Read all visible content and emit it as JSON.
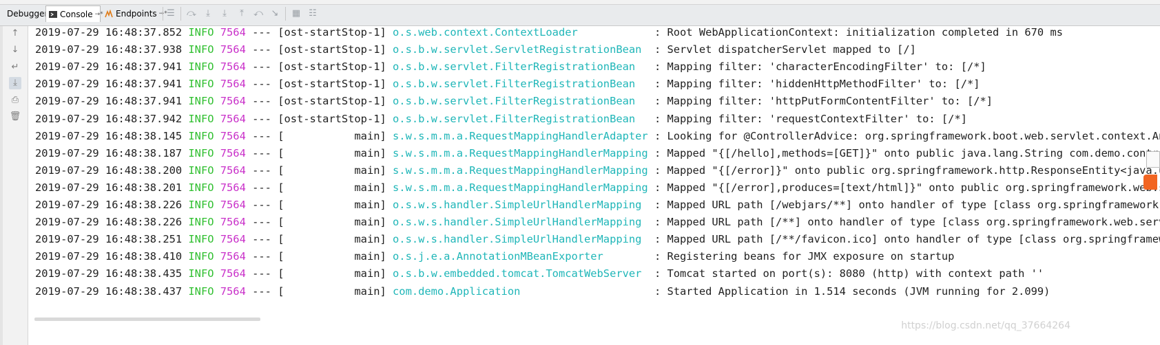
{
  "tabs": [
    {
      "label": "Debugger",
      "icon": "none"
    },
    {
      "label": "Console",
      "icon": "console-icon",
      "pin": "→*"
    },
    {
      "label": "Endpoints",
      "icon": "endpoints-icon",
      "pin": "→*"
    }
  ],
  "toolbar_icons": [
    "menu-icon",
    "step-over-icon",
    "step-into-icon",
    "force-step-into-icon",
    "step-out-icon",
    "drop-frame-icon",
    "run-to-cursor-icon",
    "evaluate-icon",
    "trace-icon"
  ],
  "sidebar_icons": [
    "up-arrow-icon",
    "down-arrow-icon",
    "soft-wrap-icon",
    "scroll-to-end-icon",
    "print-icon",
    "clear-icon"
  ],
  "colors": {
    "level": "#2fbf2f",
    "pid": "#c930c9",
    "logger": "#1fb6b8",
    "text": "#1f1f1f"
  },
  "log": [
    {
      "ts": "2019-07-29 16:48:37.852",
      "level": "INFO",
      "pid": "7564",
      "sep": "---",
      "thread": "[ost-startStop-1]",
      "logger": "o.s.web.context.ContextLoader           ",
      "message": ": Root WebApplicationContext: initialization completed in 670 ms"
    },
    {
      "ts": "2019-07-29 16:48:37.938",
      "level": "INFO",
      "pid": "7564",
      "sep": "---",
      "thread": "[ost-startStop-1]",
      "logger": "o.s.b.w.servlet.ServletRegistrationBean ",
      "message": ": Servlet dispatcherServlet mapped to [/]"
    },
    {
      "ts": "2019-07-29 16:48:37.941",
      "level": "INFO",
      "pid": "7564",
      "sep": "---",
      "thread": "[ost-startStop-1]",
      "logger": "o.s.b.w.servlet.FilterRegistrationBean  ",
      "message": ": Mapping filter: 'characterEncodingFilter' to: [/*]"
    },
    {
      "ts": "2019-07-29 16:48:37.941",
      "level": "INFO",
      "pid": "7564",
      "sep": "---",
      "thread": "[ost-startStop-1]",
      "logger": "o.s.b.w.servlet.FilterRegistrationBean  ",
      "message": ": Mapping filter: 'hiddenHttpMethodFilter' to: [/*]"
    },
    {
      "ts": "2019-07-29 16:48:37.941",
      "level": "INFO",
      "pid": "7564",
      "sep": "---",
      "thread": "[ost-startStop-1]",
      "logger": "o.s.b.w.servlet.FilterRegistrationBean  ",
      "message": ": Mapping filter: 'httpPutFormContentFilter' to: [/*]"
    },
    {
      "ts": "2019-07-29 16:48:37.942",
      "level": "INFO",
      "pid": "7564",
      "sep": "---",
      "thread": "[ost-startStop-1]",
      "logger": "o.s.b.w.servlet.FilterRegistrationBean  ",
      "message": ": Mapping filter: 'requestContextFilter' to: [/*]"
    },
    {
      "ts": "2019-07-29 16:48:38.145",
      "level": "INFO",
      "pid": "7564",
      "sep": "---",
      "thread": "[           main]",
      "logger": "s.w.s.m.m.a.RequestMappingHandlerAdapter",
      "message": ": Looking for @ControllerAdvice: org.springframework.boot.web.servlet.context.Annot"
    },
    {
      "ts": "2019-07-29 16:48:38.187",
      "level": "INFO",
      "pid": "7564",
      "sep": "---",
      "thread": "[           main]",
      "logger": "s.w.s.m.m.a.RequestMappingHandlerMapping",
      "message": ": Mapped \"{[/hello],methods=[GET]}\" onto public java.lang.String com.demo.controll"
    },
    {
      "ts": "2019-07-29 16:48:38.200",
      "level": "INFO",
      "pid": "7564",
      "sep": "---",
      "thread": "[           main]",
      "logger": "s.w.s.m.m.a.RequestMappingHandlerMapping",
      "message": ": Mapped \"{[/error]}\" onto public org.springframework.http.ResponseEntity<java.uti"
    },
    {
      "ts": "2019-07-29 16:48:38.201",
      "level": "INFO",
      "pid": "7564",
      "sep": "---",
      "thread": "[           main]",
      "logger": "s.w.s.m.m.a.RequestMappingHandlerMapping",
      "message": ": Mapped \"{[/error],produces=[text/html]}\" onto public org.springframework.web.ser"
    },
    {
      "ts": "2019-07-29 16:48:38.226",
      "level": "INFO",
      "pid": "7564",
      "sep": "---",
      "thread": "[           main]",
      "logger": "o.s.w.s.handler.SimpleUrlHandlerMapping ",
      "message": ": Mapped URL path [/webjars/**] onto handler of type [class org.springframework.web"
    },
    {
      "ts": "2019-07-29 16:48:38.226",
      "level": "INFO",
      "pid": "7564",
      "sep": "---",
      "thread": "[           main]",
      "logger": "o.s.w.s.handler.SimpleUrlHandlerMapping ",
      "message": ": Mapped URL path [/**] onto handler of type [class org.springframework.web.servlet"
    },
    {
      "ts": "2019-07-29 16:48:38.251",
      "level": "INFO",
      "pid": "7564",
      "sep": "---",
      "thread": "[           main]",
      "logger": "o.s.w.s.handler.SimpleUrlHandlerMapping ",
      "message": ": Mapped URL path [/**/favicon.ico] onto handler of type [class org.springframework"
    },
    {
      "ts": "2019-07-29 16:48:38.410",
      "level": "INFO",
      "pid": "7564",
      "sep": "---",
      "thread": "[           main]",
      "logger": "o.s.j.e.a.AnnotationMBeanExporter       ",
      "message": ": Registering beans for JMX exposure on startup"
    },
    {
      "ts": "2019-07-29 16:48:38.435",
      "level": "INFO",
      "pid": "7564",
      "sep": "---",
      "thread": "[           main]",
      "logger": "o.s.b.w.embedded.tomcat.TomcatWebServer ",
      "message": ": Tomcat started on port(s): 8080 (http) with context path ''"
    },
    {
      "ts": "2019-07-29 16:48:38.437",
      "level": "INFO",
      "pid": "7564",
      "sep": "---",
      "thread": "[           main]",
      "logger": "com.demo.Application                    ",
      "message": ": Started Application in 1.514 seconds (JVM running for 2.099)"
    }
  ],
  "watermark": "https://blog.csdn.net/qq_37664264"
}
